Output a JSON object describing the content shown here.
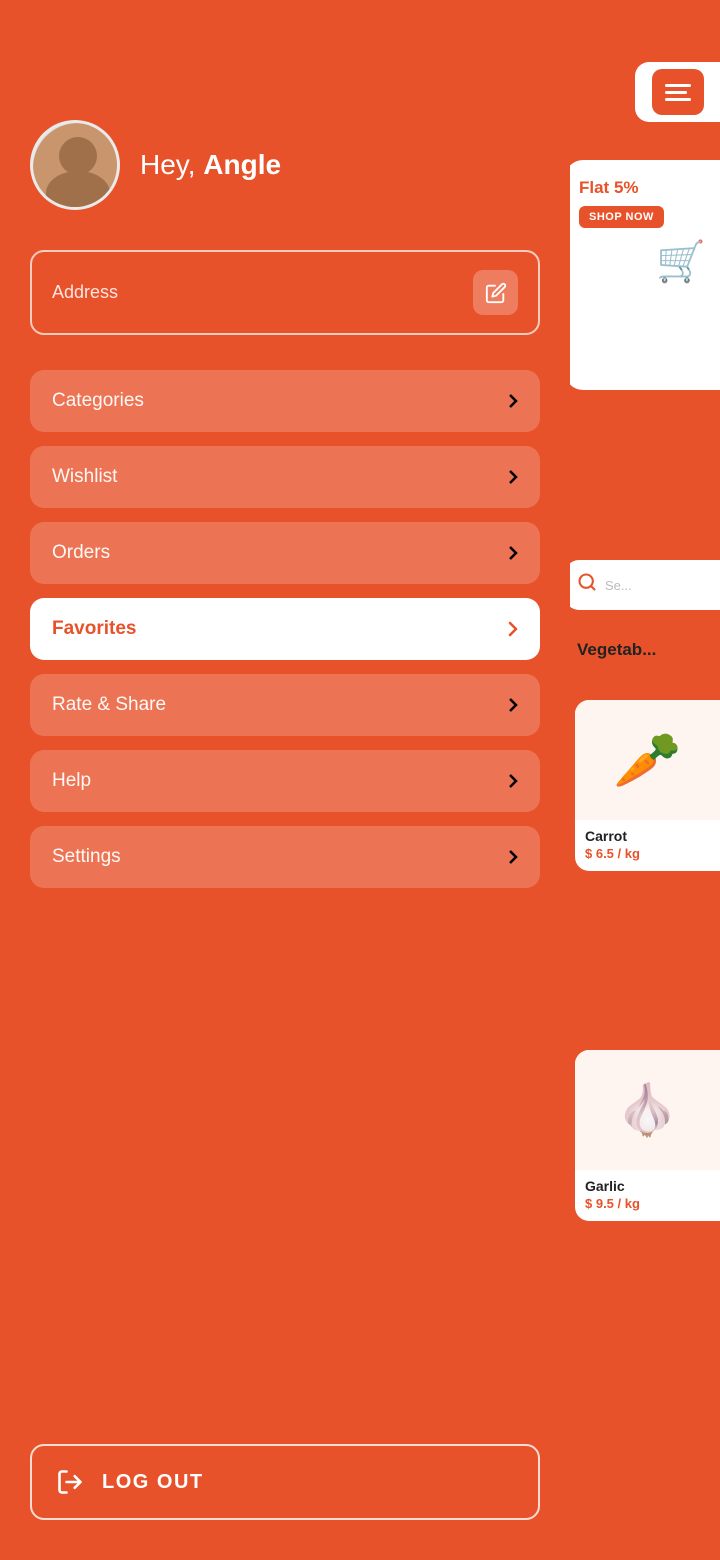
{
  "app": {
    "background_color": "#E8522A"
  },
  "sidebar": {
    "greeting_prefix": "Hey,",
    "greeting_name": "Angle",
    "address_placeholder": "Address",
    "menu_items": [
      {
        "id": "categories",
        "label": "Categories",
        "active": false
      },
      {
        "id": "wishlist",
        "label": "Wishlist",
        "active": false
      },
      {
        "id": "orders",
        "label": "Orders",
        "active": false
      },
      {
        "id": "favorites",
        "label": "Favorites",
        "active": true
      },
      {
        "id": "rate-share",
        "label": "Rate & Share",
        "active": false
      },
      {
        "id": "help",
        "label": "Help",
        "active": false
      },
      {
        "id": "settings",
        "label": "Settings",
        "active": false
      }
    ],
    "logout_label": "LOG OUT"
  },
  "right_panel": {
    "promo_text": "Flat 5%",
    "shop_now": "SHOP NOW",
    "search_placeholder": "Se...",
    "vegetables_label": "Vegetab...",
    "products": [
      {
        "id": "carrot",
        "name": "Carrot",
        "price": "$ 6.5 / kg",
        "emoji": "🥕"
      },
      {
        "id": "garlic",
        "name": "Garlic",
        "price": "$ 9.5 / kg",
        "emoji": "🧄"
      }
    ]
  }
}
